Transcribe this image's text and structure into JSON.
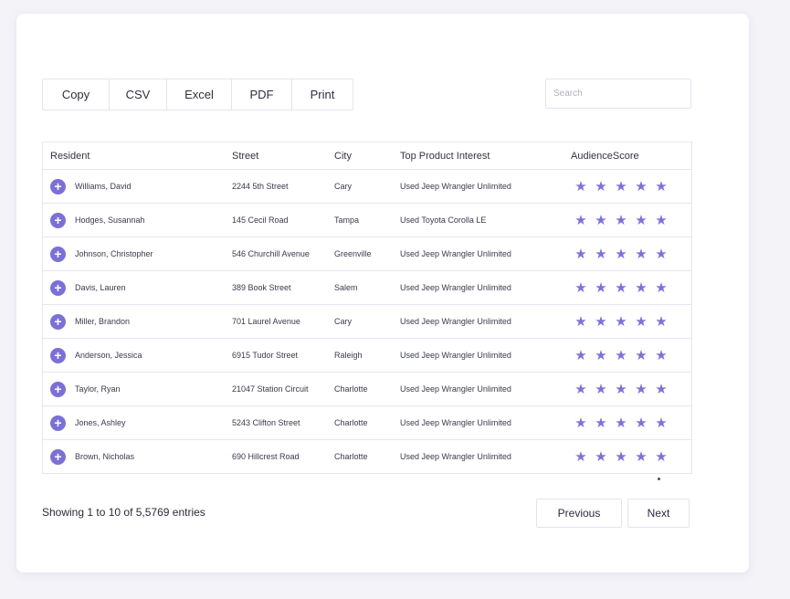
{
  "toolbar": {
    "buttons": [
      "Copy",
      "CSV",
      "Excel",
      "PDF",
      "Print"
    ],
    "search_placeholder": "Search"
  },
  "table": {
    "columns": [
      "Resident",
      "Street",
      "City",
      "Top Product Interest",
      "AudienceScore"
    ],
    "rows": [
      {
        "resident": "Williams, David",
        "street": "2244 5th Street",
        "city": "Cary",
        "interest": "Used Jeep Wrangler Unlimited",
        "score": 5
      },
      {
        "resident": "Hodges, Susannah",
        "street": "145 Cecil Road",
        "city": "Tampa",
        "interest": "Used Toyota Corolla LE",
        "score": 5
      },
      {
        "resident": "Johnson, Christopher",
        "street": "546 Churchill Avenue",
        "city": "Greenville",
        "interest": "Used Jeep Wrangler Unlimited",
        "score": 5
      },
      {
        "resident": "Davis, Lauren",
        "street": "389 Book Street",
        "city": "Salem",
        "interest": "Used Jeep Wrangler Unlimited",
        "score": 5
      },
      {
        "resident": "Miller, Brandon",
        "street": "701 Laurel Avenue",
        "city": "Cary",
        "interest": "Used Jeep Wrangler Unlimited",
        "score": 5
      },
      {
        "resident": "Anderson, Jessica",
        "street": "6915 Tudor Street",
        "city": "Raleigh",
        "interest": "Used Jeep Wrangler Unlimited",
        "score": 5
      },
      {
        "resident": "Taylor, Ryan",
        "street": "21047 Station Circuit",
        "city": "Charlotte",
        "interest": "Used Jeep Wrangler Unlimited",
        "score": 5
      },
      {
        "resident": "Jones, Ashley",
        "street": "5243 Clifton Street",
        "city": "Charlotte",
        "interest": "Used Jeep Wrangler Unlimited",
        "score": 5
      },
      {
        "resident": "Brown, Nicholas",
        "street": "690 Hillcrest Road",
        "city": "Charlotte",
        "interest": "Used Jeep Wrangler Unlimited",
        "score": 5
      }
    ]
  },
  "footer": {
    "info": "Showing 1 to 10 of 5,5769 entries",
    "previous": "Previous",
    "next": "Next"
  },
  "colors": {
    "accent": "#7b70d6",
    "star": "#7d72d8",
    "border": "#e6e6f0"
  },
  "icons": {
    "expand": "plus-circle-icon",
    "rating": "star-icon"
  }
}
